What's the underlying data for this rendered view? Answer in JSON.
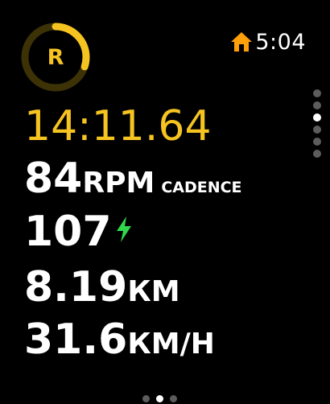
{
  "header": {
    "ring_letter": "R",
    "ring_progress": 0.3,
    "ring_color": "#f6c421",
    "ring_track_color": "#3d3106",
    "home_icon": "house-icon",
    "home_icon_color": "#ff9f0a",
    "clock": "5:04"
  },
  "metrics": {
    "elapsed": "14:11.64",
    "cadence_value": "84",
    "cadence_unit": "RPM",
    "cadence_label": "CADENCE",
    "power_value": "107",
    "power_icon": "lightning-bolt-icon",
    "power_icon_color": "#32d74b",
    "distance_value": "8.19",
    "distance_unit": "КМ",
    "speed_value": "31.6",
    "speed_unit": "КМ/Н"
  },
  "pagination": {
    "vertical_dot_count": 6,
    "vertical_active_index": 2,
    "horizontal_dot_count": 3,
    "horizontal_active_index": 1
  }
}
